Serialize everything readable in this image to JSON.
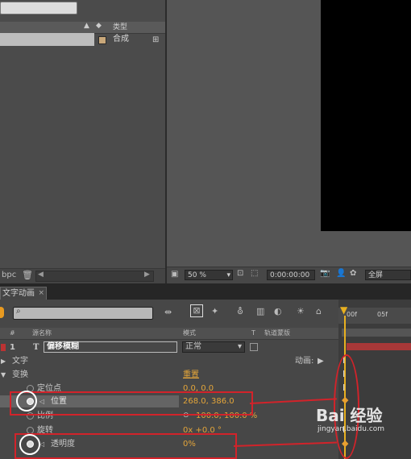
{
  "project": {
    "type_header": "类型",
    "comp_name": "合成",
    "bottom_label": "bpc"
  },
  "viewer": {
    "zoom": "50 %",
    "timecode": "0:00:00:00",
    "view_mode": "全屏"
  },
  "timeline": {
    "tab_label": "文字动画",
    "columns": {
      "num": "#",
      "source_name": "源名称",
      "mode": "模式",
      "t": "T",
      "track_matte": "轨道蒙版"
    },
    "ruler": {
      "start": "00f",
      "next": "05f"
    },
    "layer": {
      "index": "1",
      "type_glyph": "T",
      "name": "偏移模糊",
      "mode": "正常"
    },
    "rows": {
      "text": "文字",
      "animate": "动画:",
      "transform": "变换",
      "reset": "重置",
      "anchor": "定位点",
      "anchor_value": "0.0, 0.0",
      "position": "位置",
      "position_value": "268.0, 386.0",
      "scale": "比例",
      "scale_value": "100.0, 100.0 %",
      "rotation": "旋转",
      "rotation_value": "0x +0.0 °",
      "opacity": "透明度",
      "opacity_value": "0%"
    }
  },
  "watermark": {
    "brand": "Bai 经验",
    "url": "jingyan.baidu.com"
  },
  "colors": {
    "annotation": "#d2232a",
    "accent": "#e3a53a",
    "playhead": "#e8b020"
  }
}
